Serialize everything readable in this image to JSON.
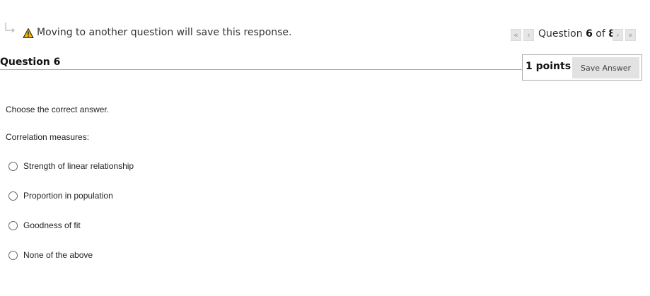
{
  "notice": {
    "warning_icon": "warning-triangle-icon",
    "text": "Moving to another question will save this response."
  },
  "navigation": {
    "question_label": "Question",
    "current": "6",
    "of_label": "of",
    "total": "8",
    "first_glyph": "«",
    "prev_glyph": "‹",
    "next_glyph": "›",
    "last_glyph": "»"
  },
  "question": {
    "title": "Question 6",
    "points": "1 points",
    "save_label": "Save Answer",
    "instruction": "Choose the correct answer.",
    "prompt": "Correlation measures:",
    "options": [
      {
        "label": "Strength of linear relationship"
      },
      {
        "label": "Proportion in population"
      },
      {
        "label": "Goodness of fit"
      },
      {
        "label": "None of the above"
      }
    ]
  },
  "colors": {
    "warning": "#f0b400",
    "nav_button_bg": "#e6e6e6",
    "save_button_bg": "#e2e2e2",
    "rule": "#a9a9a9"
  }
}
